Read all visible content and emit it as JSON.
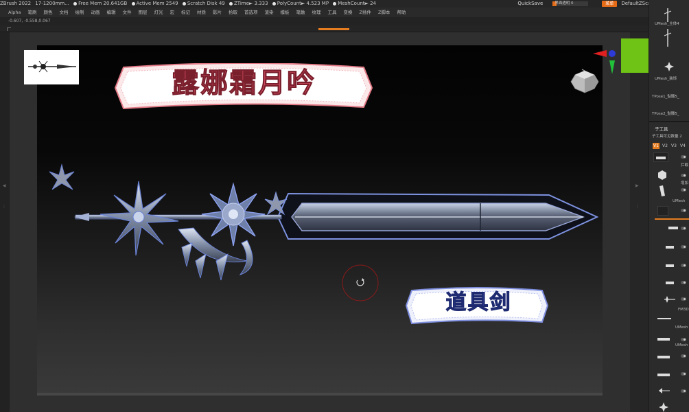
{
  "titlebar": {
    "app": "ZBrush 2022",
    "doc": "17-1200mm...",
    "free_mem": "Free Mem 20.641GB",
    "active_mem": "Active Mem 2549",
    "scratch": "Scratch Disk 49",
    "ztime": "ZTime► 3.333",
    "polycount": "PolyCount► 4.523 MP",
    "meshcount": "MeshCount► 24",
    "quicksave": "QuickSave",
    "slider_label": "界面透明 0",
    "menu_toggle": "菜单",
    "script": "DefaultZScript"
  },
  "menus": [
    "Alpha",
    "笔刷",
    "颜色",
    "文档",
    "绘制",
    "动画",
    "编辑",
    "文件",
    "图层",
    "灯光",
    "宏",
    "标记",
    "材质",
    "影片",
    "拾取",
    "首选项",
    "渲染",
    "模板",
    "笔触",
    "纹理",
    "工具",
    "变换",
    "Z插件",
    "Z脚本",
    "帮助"
  ],
  "coords": "-0.607, -0.558,0.067",
  "banners": {
    "title": "露娜霜月吟",
    "subtitle": "道具剑"
  },
  "colors": {
    "accent": "#e57c20",
    "green": "#6fc316",
    "title_red": "#e4546a",
    "subtitle_blue": "#4357c2"
  },
  "rightpanel": {
    "top_items": [
      "UMesh_主体4",
      "UMesh_装饰",
      "TPose1_骷髅5_",
      "TPose2_骷髅5_"
    ],
    "subtool_title": "子工具",
    "subtool_subtitle": "子工具可见数量 2",
    "tabs": [
      "V1",
      "V2",
      "V3",
      "V4"
    ],
    "labels": [
      "拦截",
      "增加",
      "UMesh",
      "FM3D",
      "UMesh",
      "UMesh"
    ]
  }
}
